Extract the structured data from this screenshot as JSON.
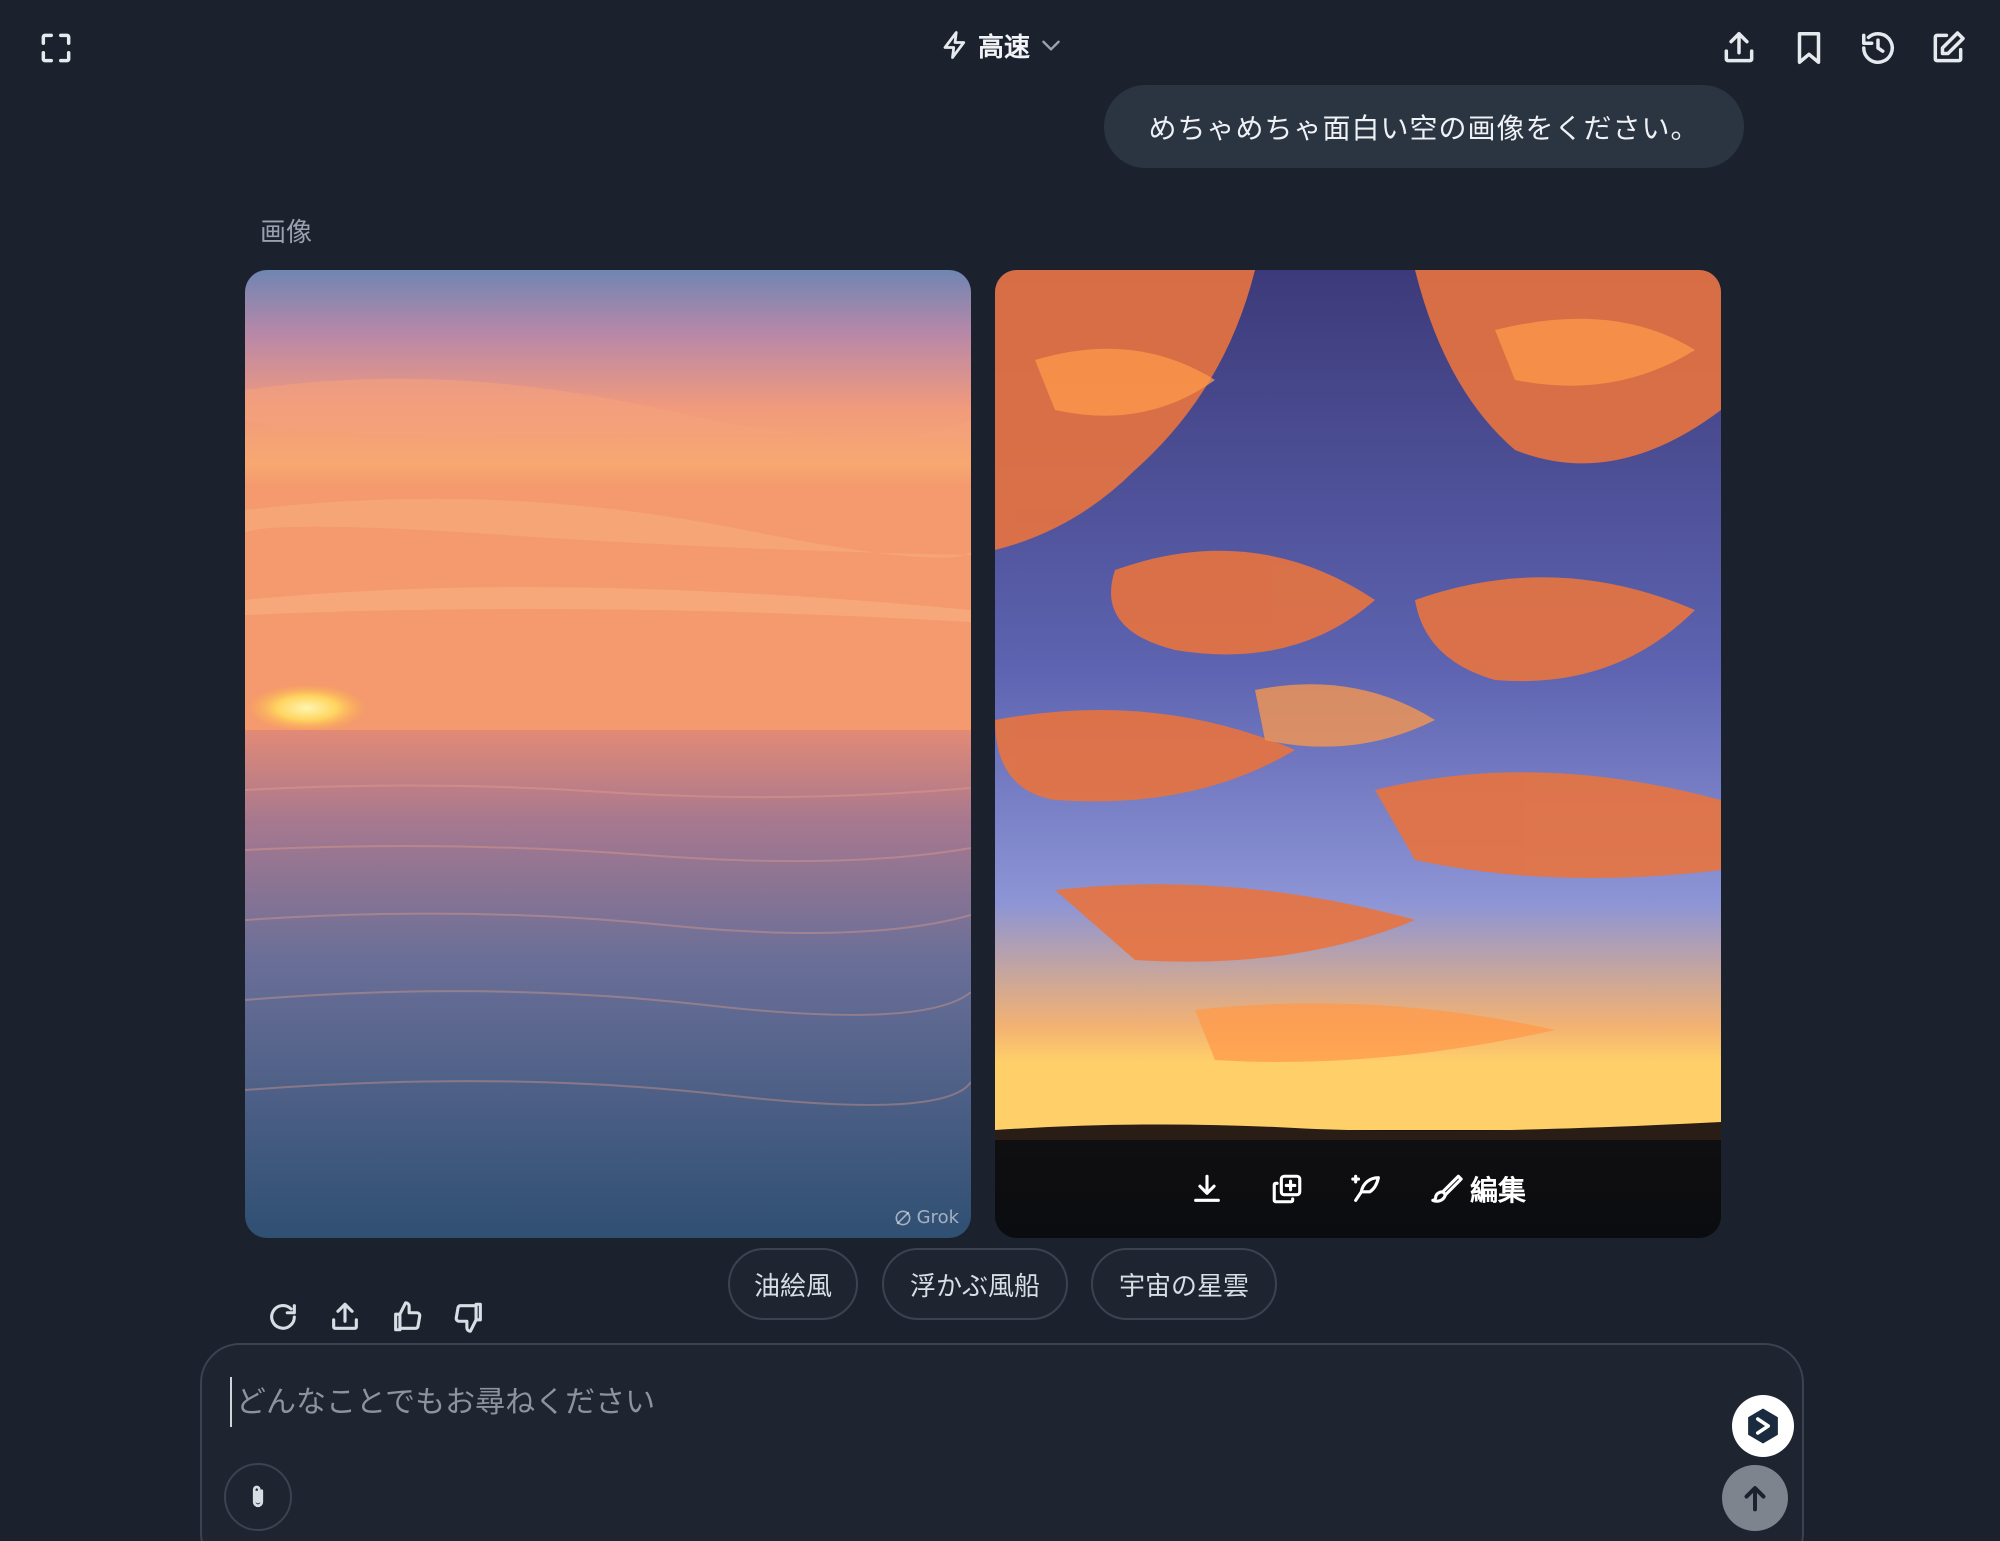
{
  "header": {
    "mode_label": "高速",
    "icons": [
      "fullscreen-icon",
      "lightning-icon",
      "chevron-down-icon",
      "share-icon",
      "bookmark-icon",
      "history-icon",
      "compose-icon"
    ]
  },
  "conversation": {
    "user_message": "めちゃめちゃ面白い空の画像をください。",
    "section_label": "画像",
    "images": [
      {
        "watermark": "Grok"
      },
      {
        "toolbar": {
          "edit_label": "編集"
        }
      }
    ]
  },
  "suggestions": [
    "油絵風",
    "浮かぶ風船",
    "宇宙の星雲"
  ],
  "composer": {
    "placeholder": "どんなことでもお尋ねください"
  },
  "colors": {
    "background": "#1b222d",
    "bubble": "#2b3441",
    "chip_border": "#3a4350",
    "send_button": "#7d848e"
  }
}
